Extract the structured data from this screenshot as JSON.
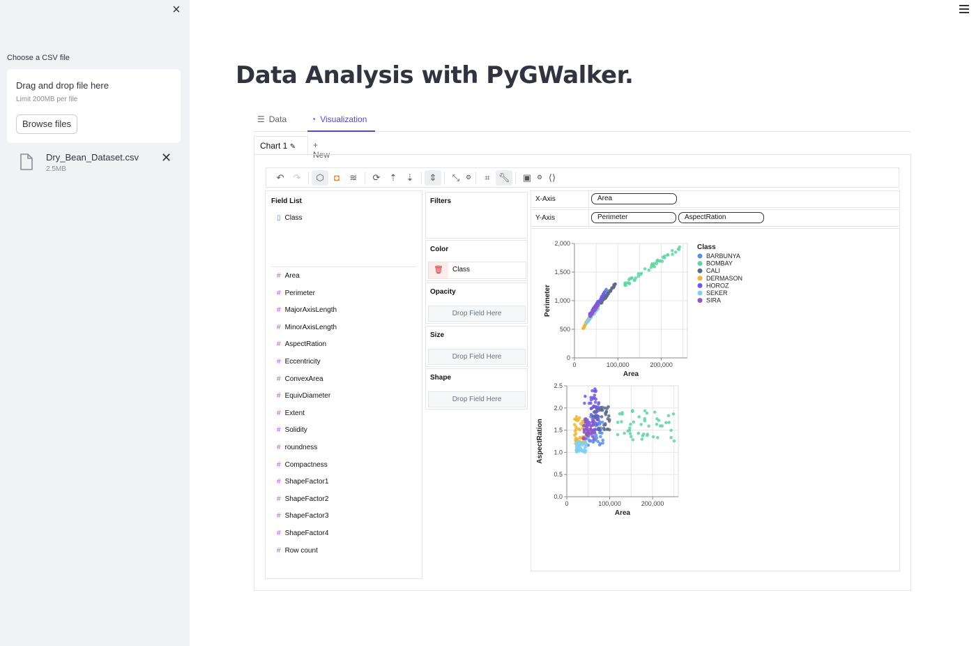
{
  "sidebar": {
    "uploader_label": "Choose a CSV file",
    "drop_title": "Drag and drop file here",
    "drop_limit": "Limit 200MB per file",
    "browse_label": "Browse files",
    "file": {
      "name": "Dry_Bean_Dataset.csv",
      "size": "2.5MB"
    }
  },
  "page_title": "Data Analysis with PyGWalker.",
  "tabs": [
    {
      "label": "Data"
    },
    {
      "label": "Visualization"
    }
  ],
  "chart_tabs": {
    "active": "Chart 1",
    "new_label": "+ New"
  },
  "field_list": {
    "title": "Field List",
    "dimensions": [
      "Class"
    ],
    "measures": [
      "Area",
      "Perimeter",
      "MajorAxisLength",
      "MinorAxisLength",
      "AspectRation",
      "Eccentricity",
      "ConvexArea",
      "EquivDiameter",
      "Extent",
      "Solidity",
      "roundness",
      "Compactness",
      "ShapeFactor1",
      "ShapeFactor2",
      "ShapeFactor3",
      "ShapeFactor4",
      "Row count"
    ]
  },
  "encodings": {
    "filters_title": "Filters",
    "color_title": "Color",
    "color_field": "Class",
    "opacity_title": "Opacity",
    "size_title": "Size",
    "shape_title": "Shape",
    "drop_placeholder": "Drop Field Here"
  },
  "axes": {
    "x_label": "X-Axis",
    "y_label": "Y-Axis",
    "x_fields": [
      "Area"
    ],
    "y_fields": [
      "Perimeter",
      "AspectRation"
    ]
  },
  "colors": {
    "accent": "#4f46e5",
    "BARBUNYA": "#5b8def",
    "BOMBAY": "#5ed6a1",
    "CALI": "#5a6b8c",
    "DERMASON": "#f2b630",
    "HOROZ": "#6f5ae8",
    "SEKER": "#7fcff5",
    "SIRA": "#8e58c9"
  },
  "chart_data": [
    {
      "type": "scatter",
      "xlabel": "Area",
      "ylabel": "Perimeter",
      "xlim": [
        0,
        260000
      ],
      "ylim": [
        0,
        2000
      ],
      "x_ticks": [
        "0",
        "100,000",
        "200,000"
      ],
      "y_ticks": [
        "0",
        "500",
        "1,000",
        "1,500",
        "2,000"
      ],
      "legend_title": "Class",
      "legend_position": "right",
      "series": [
        {
          "name": "BARBUNYA",
          "clusters": [
            {
              "x": [
                45000,
                75000
              ],
              "y": [
                800,
                1200
              ]
            }
          ]
        },
        {
          "name": "BOMBAY",
          "clusters": [
            {
              "x": [
                115000,
                255000
              ],
              "y": [
                1280,
                1990
              ]
            }
          ]
        },
        {
          "name": "CALI",
          "clusters": [
            {
              "x": [
                60000,
                95000
              ],
              "y": [
                950,
                1300
              ]
            }
          ]
        },
        {
          "name": "DERMASON",
          "clusters": [
            {
              "x": [
                20000,
                42000
              ],
              "y": [
                520,
                800
              ]
            }
          ]
        },
        {
          "name": "HOROZ",
          "clusters": [
            {
              "x": [
                35000,
                70000
              ],
              "y": [
                750,
                1150
              ]
            }
          ]
        },
        {
          "name": "SEKER",
          "clusters": [
            {
              "x": [
                28000,
                55000
              ],
              "y": [
                620,
                880
              ]
            }
          ]
        },
        {
          "name": "SIRA",
          "clusters": [
            {
              "x": [
                35000,
                55000
              ],
              "y": [
                720,
                930
              ]
            }
          ]
        }
      ]
    },
    {
      "type": "scatter",
      "xlabel": "Area",
      "ylabel": "AspectRation",
      "xlim": [
        0,
        260000
      ],
      "ylim": [
        0,
        2.5
      ],
      "x_ticks": [
        "0",
        "100,000",
        "200,000"
      ],
      "y_ticks": [
        "0.0",
        "0.5",
        "1.0",
        "1.5",
        "2.0",
        "2.5"
      ],
      "series": [
        {
          "name": "BARBUNYA",
          "clusters": [
            {
              "x": [
                45000,
                85000
              ],
              "y": [
                1.15,
                1.85
              ]
            }
          ]
        },
        {
          "name": "BOMBAY",
          "clusters": [
            {
              "x": [
                115000,
                255000
              ],
              "y": [
                1.25,
                1.95
              ]
            }
          ]
        },
        {
          "name": "CALI",
          "clusters": [
            {
              "x": [
                60000,
                100000
              ],
              "y": [
                1.5,
                2.05
              ]
            }
          ]
        },
        {
          "name": "DERMASON",
          "clusters": [
            {
              "x": [
                18000,
                42000
              ],
              "y": [
                1.15,
                1.85
              ]
            }
          ]
        },
        {
          "name": "HOROZ",
          "clusters": [
            {
              "x": [
                40000,
                75000
              ],
              "y": [
                1.5,
                2.45
              ]
            }
          ]
        },
        {
          "name": "SEKER",
          "clusters": [
            {
              "x": [
                22000,
                45000
              ],
              "y": [
                1.0,
                1.25
              ]
            }
          ]
        },
        {
          "name": "SIRA",
          "clusters": [
            {
              "x": [
                38000,
                65000
              ],
              "y": [
                1.3,
                1.75
              ]
            }
          ]
        }
      ]
    }
  ]
}
